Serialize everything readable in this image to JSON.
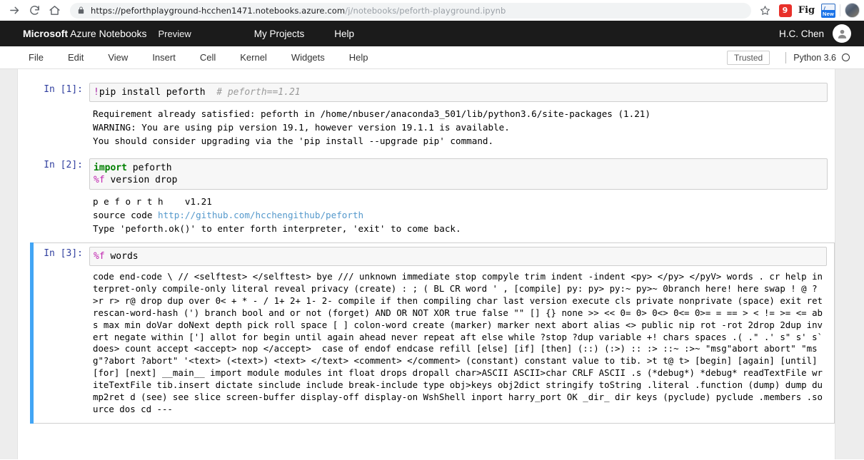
{
  "browser": {
    "url_host": "https://peforthplayground-hcchen1471.notebooks.azure.com",
    "url_path": "/j/notebooks/peforth-playground.ipynb",
    "url_full": "https://peforthplayground-hcchen1471.notebooks.azure.com/j/notebooks/peforth-playground.ipynb",
    "icons": {
      "forward": "forward-arrow-icon",
      "reload": "reload-icon",
      "home": "home-icon",
      "lock": "lock-icon",
      "star": "star-bookmark-icon",
      "ext1": "9",
      "ext2": "Fig",
      "ext3_badge": "New",
      "profile": "profile-avatar-icon"
    }
  },
  "azure_header": {
    "brand_bold": "Microsoft",
    "brand_rest": " Azure Notebooks",
    "preview": "Preview",
    "nav": [
      {
        "label": "My Projects"
      },
      {
        "label": "Help"
      }
    ],
    "user_name": "H.C. Chen"
  },
  "jupyter_menubar": {
    "items": [
      {
        "label": "File"
      },
      {
        "label": "Edit"
      },
      {
        "label": "View"
      },
      {
        "label": "Insert"
      },
      {
        "label": "Cell"
      },
      {
        "label": "Kernel"
      },
      {
        "label": "Widgets"
      },
      {
        "label": "Help"
      }
    ],
    "trusted": "Trusted",
    "kernel_name": "Python 3.6",
    "kernel_status": "idle"
  },
  "notebook": {
    "cells": [
      {
        "prompt": "In [1]:",
        "code_main": "!pip install peforth  ",
        "code_bang": "!",
        "code_rest": "pip install peforth  ",
        "code_comment": "# peforth==1.21",
        "selected": false,
        "output_lines": [
          {
            "text": "Requirement already satisfied: peforth in /home/nbuser/anaconda3_501/lib/python3.6/site-packages (1.21)",
            "style": "plain"
          },
          {
            "text": "WARNING: You are using pip version 19.1, however version 19.1.1 is available.",
            "style": "warn"
          },
          {
            "text": "You should consider upgrading via the 'pip install --upgrade pip' command.",
            "style": "warn"
          }
        ]
      },
      {
        "prompt": "In [2]:",
        "code_kw": "import",
        "code_after_kw": " peforth",
        "code_magic": "%f",
        "code_after_magic": " version drop",
        "selected": false,
        "output_lines": [
          {
            "text": "p e f o r t h    v1.21",
            "style": "plain"
          },
          {
            "text": "source code ",
            "style": "plain",
            "link": "http://github.com/hcchengithub/peforth"
          },
          {
            "text": "Type 'peforth.ok()' to enter forth interpreter, 'exit' to come back.",
            "style": "plain"
          }
        ]
      },
      {
        "prompt": "In [3]:",
        "code_magic": "%f",
        "code_after_magic": " words",
        "selected": true,
        "words_output": "code end-code \\ // <selftest> </selftest> bye /// unknown immediate stop compyle trim indent -indent <py> </py> </pyV> words . cr help interpret-only compile-only literal reveal privacy (create) : ; ( BL CR word ' , [compile] py: py> py:~ py>~ 0branch here! here swap ! @ ? >r r> r@ drop dup over 0< + * - / 1+ 2+ 1- 2- compile if then compiling char last version execute cls private nonprivate (space) exit ret rescan-word-hash (') branch bool and or not (forget) AND OR NOT XOR true false \"\" [] {} none >> << 0= 0> 0<> 0<= 0>= = == > < != >= <= abs max min doVar doNext depth pick roll space [ ] colon-word create (marker) marker next abort alias <> public nip rot -rot 2drop 2dup invert negate within ['] allot for begin until again ahead never repeat aft else while ?stop ?dup variable +! chars spaces .( .\" .' s\" s' s` does> count accept <accept> nop </accept>  case of endof endcase refill [else] [if] [then] (::) (:>) :: :> ::~ :>~ \"msg\"abort abort\" \"msg\"?abort ?abort\" '<text> (<text>) <text> </text> <comment> </comment> (constant) constant value to tib. >t t@ t> [begin] [again] [until] [for] [next] __main__ import module modules int float drops dropall char>ASCII ASCII>char CRLF ASCII .s (*debug*) *debug* readTextFile writeTextFile tib.insert dictate sinclude include break-include type obj>keys obj2dict stringify toString .literal .function (dump) dump dump2ret d (see) see slice screen-buffer display-off display-on WshShell inport harry_port OK _dir_ dir keys (pyclude) pyclude .members .source dos cd ---"
      }
    ]
  },
  "colors": {
    "accent_blue": "#42a5f5",
    "prompt_blue": "#303f9f",
    "warn_orange": "#d9a33a",
    "link_blue": "#5599cc",
    "header_dark": "#1b1b1b",
    "page_bg": "#ededed"
  }
}
